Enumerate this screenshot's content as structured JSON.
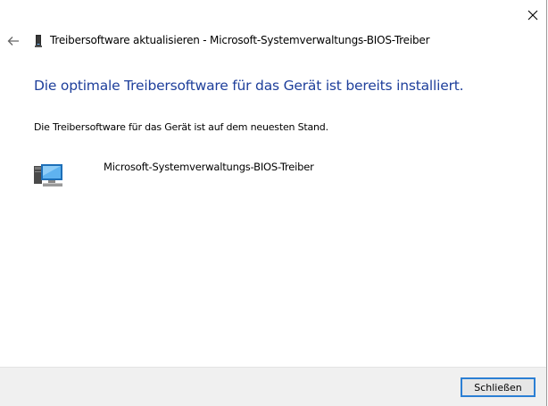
{
  "window": {
    "close_icon": "close-icon"
  },
  "header": {
    "back_icon": "back-arrow-icon",
    "device_icon": "device-icon",
    "title": "Treibersoftware aktualisieren - Microsoft-Systemverwaltungs-BIOS-Treiber"
  },
  "main": {
    "heading": "Die optimale Treibersoftware für das Gerät ist bereits installiert.",
    "status": "Die Treibersoftware für das Gerät ist auf dem neuesten Stand.",
    "device_icon": "computer-device-icon",
    "device_name": "Microsoft-Systemverwaltungs-BIOS-Treiber"
  },
  "footer": {
    "close_button_label": "Schließen"
  },
  "colors": {
    "heading": "#1e3f9b",
    "footer_bg": "#f0f0f0",
    "button_border": "#2b7fd4"
  }
}
